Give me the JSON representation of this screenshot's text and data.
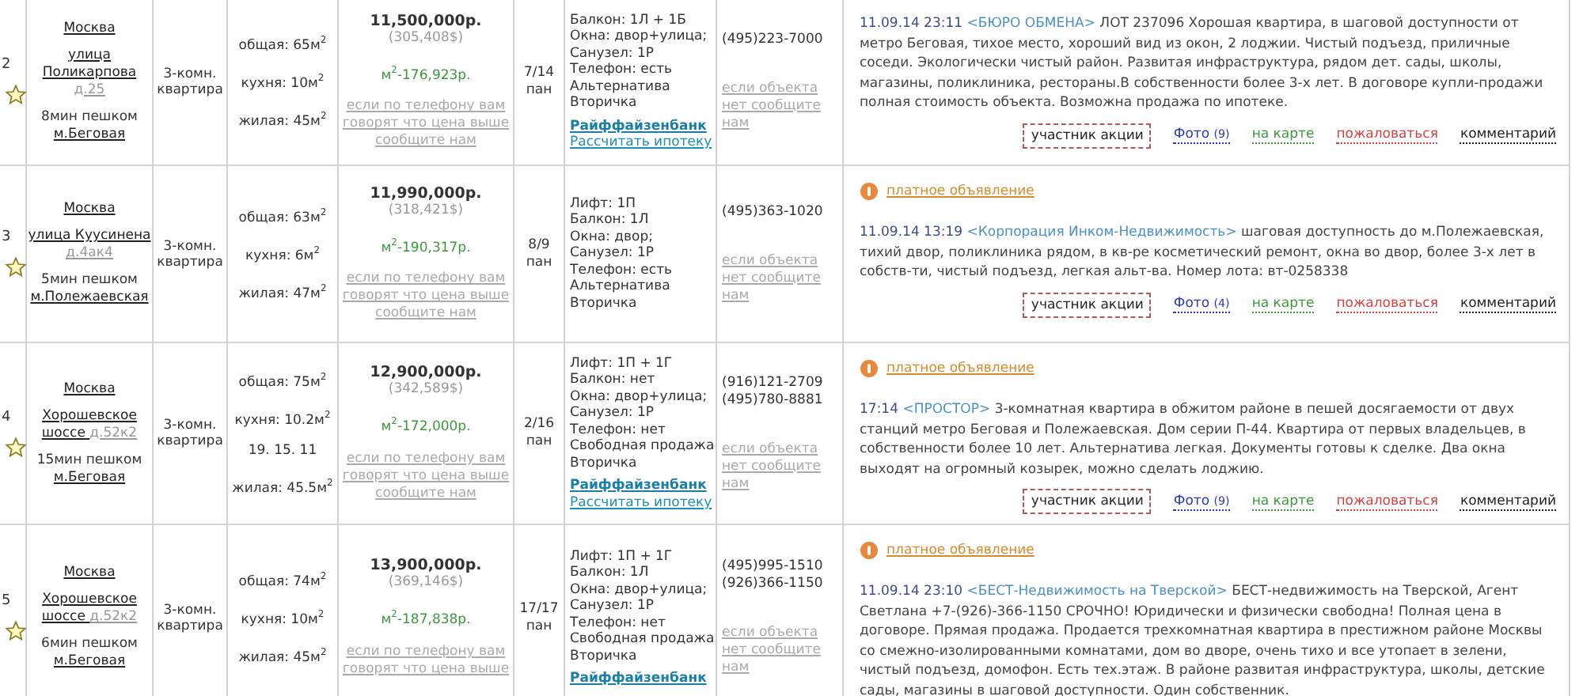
{
  "listings": [
    {
      "number": "2",
      "city": "Москва",
      "street": "улица Поликарпова",
      "house": "д.25",
      "walk": "8мин пешком",
      "metro": "м.Беговая",
      "type": "3-комн. квартира",
      "areas": [
        "общая: 65м$^{2}$",
        "кухня: 10м$^{2}$",
        "жилая: 45м$^{2}$"
      ],
      "price": "11,500,000р.",
      "price_usd": "(305,408$)",
      "price_per_m2": "м$^{2}$-176,923р.",
      "price_note": "если по телефону вам говорят что цена выше сообщите нам",
      "floor": "7/14",
      "material": "пан",
      "details": [
        "Балкон: 1Л + 1Б",
        "Окна: двор+улица;",
        "Санузел: 1Р",
        "Телефон: есть",
        "Альтернатива",
        "Вторичка"
      ],
      "bank": "Райффайзенбанк",
      "mortgage": "Рассчитать ипотеку",
      "phones": [
        "(495)223-7000"
      ],
      "phone_note": "если объекта нет сообщите нам",
      "date": "11.09.14 23:11",
      "agency": "<БЮРО ОБМЕНА>",
      "text": "ЛОТ 237096 Хорошая квартира, в шаговой доступности от метро Беговая, тихое место, хороший вид из окон, 2 лоджии. Чистый подъезд, приличные соседи. Экологически чистый район. Развитая инфраструктура, рядом дет. сады, школы, магазины, поликлиника, рестораны.В собственности более 3-х лет. В договоре купли-продажи полная стоимость объекта. Возможна продажа по ипотеке.",
      "actions": [
        {
          "kind": "promo",
          "label": "участник акции"
        },
        {
          "kind": "photo",
          "label": "Фото",
          "count": "(9)"
        },
        {
          "kind": "map",
          "label": "на карте"
        },
        {
          "kind": "complain",
          "label": "пожаловаться"
        },
        {
          "kind": "comment",
          "label": "комментарий"
        }
      ]
    },
    {
      "number": "3",
      "city": "Москва",
      "street": "улица Куусинена",
      "house": "д.4ак4",
      "walk": "5мин пешком",
      "metro": "м.Полежаевская",
      "type": "3-комн. квартира",
      "areas": [
        "общая: 63м$^{2}$",
        "кухня: 6м$^{2}$",
        "жилая: 47м$^{2}$"
      ],
      "price": "11,990,000р.",
      "price_usd": "(318,421$)",
      "price_per_m2": "м$^{2}$-190,317р.",
      "price_note": "если по телефону вам говорят что цена выше сообщите нам",
      "floor": "8/9",
      "material": "пан",
      "details": [
        "Лифт: 1П",
        "Балкон: 1Л",
        "Окна: двор;",
        "Санузел: 1Р",
        "Телефон: есть",
        "Альтернатива",
        "Вторичка"
      ],
      "phones": [
        "(495)363-1020"
      ],
      "phone_note": "если объекта нет сообщите нам",
      "badge": "платное объявление",
      "date": "11.09.14 13:19",
      "agency": "<Корпорация Инком-Недвижимость>",
      "text": "шаговая доступность до м.Полежаевская, тихий двор, поликлиника рядом, в кв-ре косметический ремонт, окна во двор, более 3-х лет в собств-ти, чистый подъезд, легкая альт-ва. Номер лота: вт-0258338",
      "actions": [
        {
          "kind": "promo",
          "label": "участник акции"
        },
        {
          "kind": "photo",
          "label": "Фото",
          "count": "(4)"
        },
        {
          "kind": "map",
          "label": "на карте"
        },
        {
          "kind": "complain",
          "label": "пожаловаться"
        },
        {
          "kind": "comment",
          "label": "комментарий"
        }
      ]
    },
    {
      "number": "4",
      "city": "Москва",
      "street": "Хорошевское шоссе",
      "house": "д.52к2",
      "walk": "15мин пешком",
      "metro": "м.Беговая",
      "type": "3-комн. квартира",
      "areas": [
        "общая: 75м$^{2}$",
        "кухня: 10.2м$^{2}$",
        "19. 15. 11",
        "жилая: 45.5м$^{2}$"
      ],
      "price": "12,900,000р.",
      "price_usd": "(342,589$)",
      "price_per_m2": "м$^{2}$-172,000р.",
      "price_note": "если по телефону вам говорят что цена выше сообщите нам",
      "floor": "2/16",
      "material": "пан",
      "details": [
        "Лифт: 1П + 1Г",
        "Балкон: нет",
        "Окна: двор+улица;",
        "Санузел: 1Р",
        "Телефон: нет",
        "Свободная продажа",
        "Вторичка"
      ],
      "bank": "Райффайзенбанк",
      "mortgage": "Рассчитать ипотеку",
      "phones": [
        "(916)121-2709",
        "(495)780-8881"
      ],
      "phone_note": "если объекта нет сообщите нам",
      "badge": "платное объявление",
      "date": "17:14",
      "agency": "<ПРОСТОР>",
      "text": "3-комнатная квартира в обжитом районе в пешей досягаемости от двух станций метро Беговая и Полежаевская. Дом серии П-44. Квартира от первых владельцев, в собственности более 10 лет. Альтернатива легкая. Документы готовы к сделке. Два окна выходят на огромный козырек, можно сделать лоджию.",
      "actions": [
        {
          "kind": "promo",
          "label": "участник акции"
        },
        {
          "kind": "photo",
          "label": "Фото",
          "count": "(9)"
        },
        {
          "kind": "map",
          "label": "на карте"
        },
        {
          "kind": "complain",
          "label": "пожаловаться"
        },
        {
          "kind": "comment",
          "label": "комментарий"
        }
      ]
    },
    {
      "number": "5",
      "city": "Москва",
      "street": "Хорошевское шоссе",
      "house": "д.52к2",
      "walk": "6мин пешком",
      "metro": "м.Беговая",
      "type": "3-комн. квартира",
      "areas": [
        "общая: 74м$^{2}$",
        "кухня: 10м$^{2}$",
        "жилая: 45м$^{2}$"
      ],
      "price": "13,900,000р.",
      "price_usd": "(369,146$)",
      "price_per_m2": "м$^{2}$-187,838р.",
      "price_note": "если по телефону вам говорят что цена выше",
      "floor": "17/17",
      "material": "пан",
      "details": [
        "Лифт: 1П + 1Г",
        "Балкон: 1Л",
        "Окна: двор+улица;",
        "Санузел: 1Р",
        "Телефон: нет",
        "Свободная продажа",
        "Вторичка"
      ],
      "bank": "Райффайзенбанк",
      "phones": [
        "(495)995-1510",
        "(926)366-1150"
      ],
      "phone_note": "если объекта нет сообщите нам",
      "badge": "платное объявление",
      "date": "11.09.14 23:10",
      "agency": "<БЕСТ-Недвижимость на Тверской>",
      "text": "БЕСТ-недвижимость на Тверской, Агент Светлана +7-(926)-366-1150 СРОЧНО! Юридически и физически свободна! Полная цена в договоре. Прямая продажа. Продается трехкомнатная квартира в престижном районе Москвы со смежно-изолированными комнатами, дом во дворе, очень тихо и все утопает в зелени, чистый подъезд, домофон. Есть тех.этаж. В районе развитая инфраструктура, школы, детские сады, магазины в шаговой доступности. Один собственник."
    }
  ]
}
